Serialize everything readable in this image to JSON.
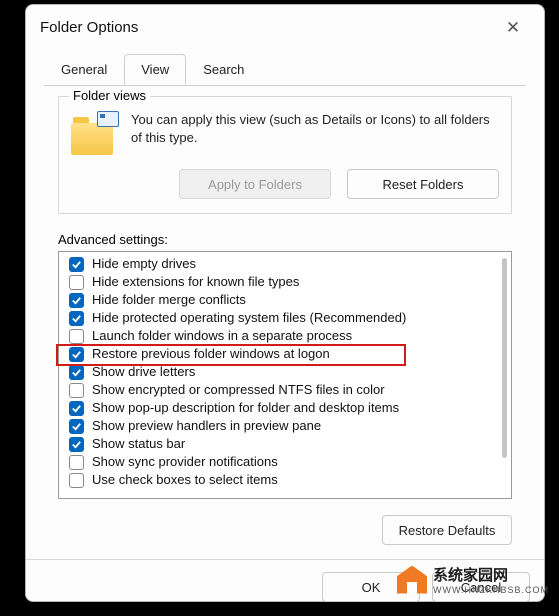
{
  "title": "Folder Options",
  "tabs": {
    "general": "General",
    "view": "View",
    "search": "Search"
  },
  "folderViews": {
    "legend": "Folder views",
    "desc": "You can apply this view (such as Details or Icons) to all folders of this type.",
    "applyBtn": "Apply to Folders",
    "resetBtn": "Reset Folders"
  },
  "advancedLabel": "Advanced settings:",
  "options": [
    {
      "checked": true,
      "label": "Hide empty drives"
    },
    {
      "checked": false,
      "label": "Hide extensions for known file types"
    },
    {
      "checked": true,
      "label": "Hide folder merge conflicts"
    },
    {
      "checked": true,
      "label": "Hide protected operating system files (Recommended)"
    },
    {
      "checked": false,
      "label": "Launch folder windows in a separate process"
    },
    {
      "checked": true,
      "label": "Restore previous folder windows at logon"
    },
    {
      "checked": true,
      "label": "Show drive letters"
    },
    {
      "checked": false,
      "label": "Show encrypted or compressed NTFS files in color"
    },
    {
      "checked": true,
      "label": "Show pop-up description for folder and desktop items"
    },
    {
      "checked": true,
      "label": "Show preview handlers in preview pane"
    },
    {
      "checked": true,
      "label": "Show status bar"
    },
    {
      "checked": false,
      "label": "Show sync provider notifications"
    },
    {
      "checked": false,
      "label": "Use check boxes to select items"
    }
  ],
  "restoreDefaults": "Restore Defaults",
  "buttons": {
    "ok": "OK",
    "cancel": "Cancel"
  },
  "watermark": {
    "main": "系统家园网",
    "sub": "WWW.HNZKHBSB.COM"
  }
}
